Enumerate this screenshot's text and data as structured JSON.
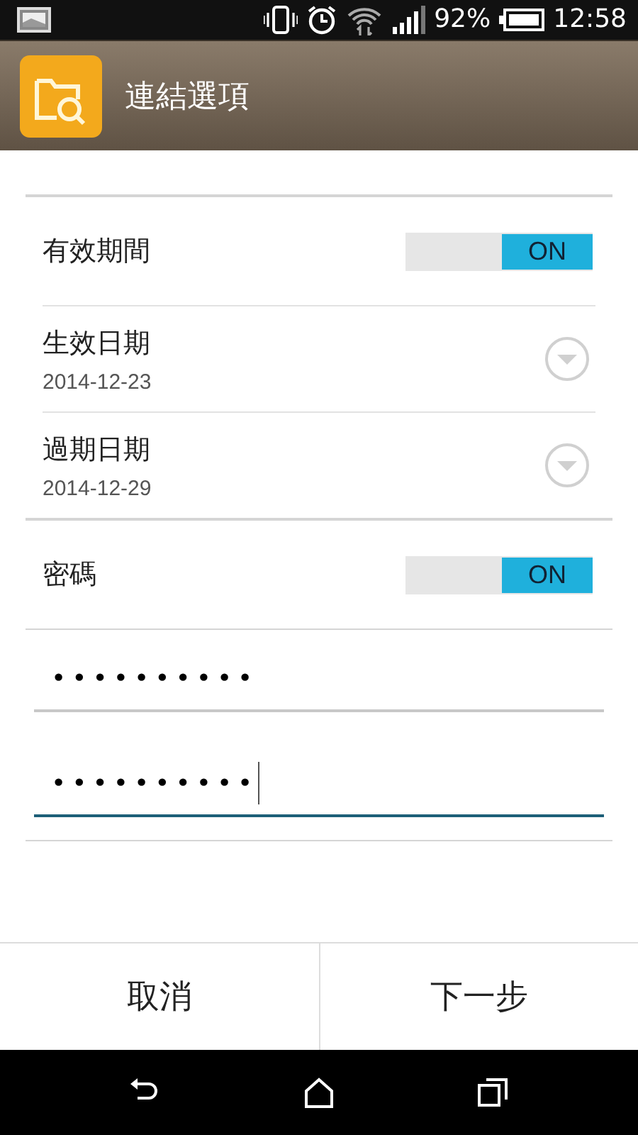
{
  "status_bar": {
    "battery": "92%",
    "time": "12:58"
  },
  "header": {
    "title": "連結選項"
  },
  "validity": {
    "label": "有效期間",
    "toggle": {
      "text": "ON",
      "on": true
    }
  },
  "dates": [
    {
      "label": "生效日期",
      "value": "2014-12-23"
    },
    {
      "label": "過期日期",
      "value": "2014-12-29"
    }
  ],
  "password": {
    "label": "密碼",
    "toggle": {
      "text": "ON",
      "on": true
    }
  },
  "password_fields": [
    {
      "value": "••••••••••",
      "focused": false
    },
    {
      "value": "••••••••••",
      "focused": true
    }
  ],
  "buttons": [
    {
      "label": "取消"
    },
    {
      "label": "下一步"
    }
  ]
}
